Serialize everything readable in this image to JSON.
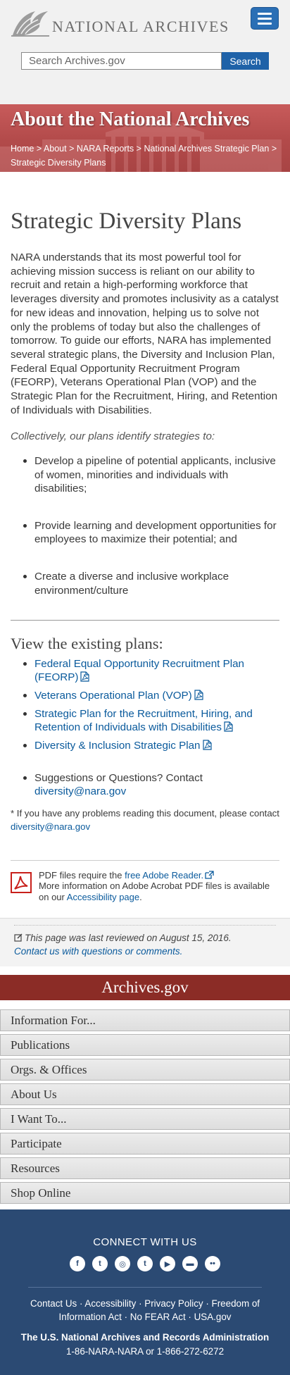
{
  "header": {
    "site_name": "NATIONAL ARCHIVES",
    "search_placeholder": "Search Archives.gov",
    "search_button": "Search"
  },
  "banner": {
    "title": "About the National Archives",
    "breadcrumb": [
      "Home",
      "About",
      "NARA Reports",
      "National Archives Strategic Plan",
      "Strategic Diversity Plans"
    ],
    "separator": ">"
  },
  "main": {
    "title": "Strategic Diversity Plans",
    "intro": "NARA understands that its most powerful tool for achieving mission success is reliant on our ability to recruit and retain a high-performing workforce that leverages diversity and promotes inclusivity as a catalyst for new ideas and innovation, helping us to solve not only the problems of today but also the challenges of tomorrow. To guide our efforts, NARA has implemented several strategic plans, the Diversity and Inclusion Plan, Federal Equal Opportunity Recruitment Program (FEORP), Veterans Operational Plan (VOP) and the Strategic Plan for the Recruitment, Hiring, and Retention of Individuals with Disabilities.",
    "lead": "Collectively, our plans identify strategies to:",
    "strategies": [
      "Develop a pipeline of potential applicants, inclusive of women, minorities and individuals with disabilities;",
      "Provide learning and development opportunities for employees to maximize their potential; and",
      "Create a diverse and inclusive workplace environment/culture"
    ],
    "plans_heading": "View the existing plans:",
    "plans": [
      "Federal Equal Opportunity Recruitment Plan (FEORP)",
      "Veterans Operational Plan (VOP)",
      "Strategic Plan for the Recruitment, Hiring, and Retention of Individuals with Disabilities",
      "Diversity & Inclusion Strategic Plan"
    ],
    "contact_prefix": "Suggestions or Questions? Contact",
    "contact_email": "diversity@nara.gov",
    "note_prefix": "* If you have any problems reading this document, please contact",
    "note_email": "diversity@nara.gov"
  },
  "pdf_notice": {
    "line1_prefix": "PDF files require the",
    "reader_link": "free Adobe Reader.",
    "line2_prefix": "More information on Adobe Acrobat PDF files is available on our",
    "accessibility_link": "Accessibility page",
    "line2_suffix": "."
  },
  "review": {
    "text": "This page was last reviewed on August 15, 2016.",
    "contact_link": "Contact us with questions or comments."
  },
  "footer": {
    "site_bar": "Archives.gov",
    "nav": [
      "Information For...",
      "Publications",
      "Orgs. & Offices",
      "About Us",
      "I Want To...",
      "Participate",
      "Resources",
      "Shop Online"
    ],
    "connect": "CONNECT WITH US",
    "social": [
      "facebook-icon",
      "twitter-icon",
      "instagram-icon",
      "tumblr-icon",
      "youtube-icon",
      "blog-icon",
      "flickr-icon"
    ],
    "links": [
      "Contact Us",
      "Accessibility",
      "Privacy Policy",
      "Freedom of Information Act",
      "No FEAR Act",
      "USA.gov"
    ],
    "link_separator": "·",
    "org": "The U.S. National Archives and Records Administration",
    "phone": "1-86-NARA-NARA or 1-866-272-6272"
  },
  "colors": {
    "brand_blue": "#2b6fb5",
    "banner_red": "#b24a4a",
    "footer_red": "#8b2c26",
    "footer_navy": "#2b4a73",
    "link": "#0a5a9c"
  }
}
